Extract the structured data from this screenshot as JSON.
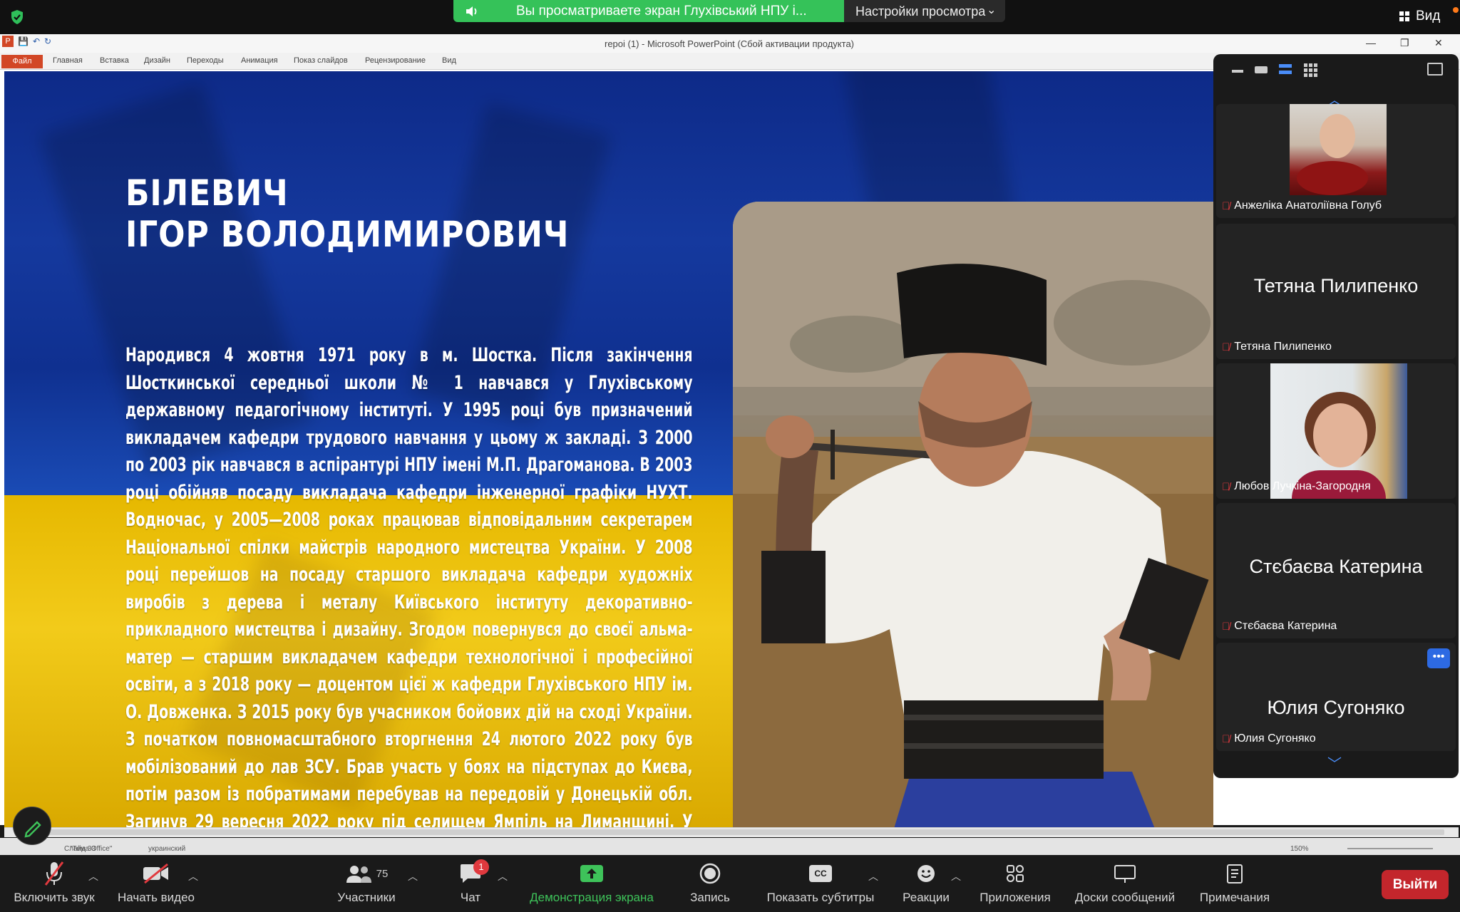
{
  "zoom_top": {
    "share_banner_text": "Вы просматриваете экран Глухівський НПУ і...",
    "view_settings_label": "Настройки просмотра",
    "view_label": "Вид"
  },
  "ppt": {
    "window_title": "repoi (1) - Microsoft PowerPoint (Сбой активации продукта)",
    "ribbon_tabs": [
      "Файл",
      "Главная",
      "Вставка",
      "Дизайн",
      "Переходы",
      "Анимация",
      "Показ слайдов",
      "Рецензирование",
      "Вид"
    ],
    "status": {
      "slide": "Слайд 33",
      "theme": "\"Тема Office\"",
      "language": "украинский",
      "zoom": "150%"
    }
  },
  "slide": {
    "title_line1": "БІЛЕВИЧ",
    "title_line2": "ІГОР ВОЛОДИМИРОВИЧ",
    "body": "Народився 4 жовтня 1971 року в м. Шостка. Після закінчення Шосткинської середньої школи № 1 навчався у Глухівському державному педагогічному інституті. У 1995 році був призначений викладачем кафедри трудового навчання у цьому ж закладі. З 2000 по 2003 рік навчався в аспірантурі НПУ імені М.П. Драгоманова. В 2003 році обійняв посаду викладача кафедри інженерної графіки НУХТ. Водночас, у 2005—2008 роках працював відповідальним секретарем Національної спілки майстрів народного мистецтва України. У 2008 році перейшов на посаду старшого викладача кафедри художніх виробів з дерева і металу Київського інституту декоративно-прикладного мистецтва і дизайну. Згодом повернувся до своєї альма-матер — старшим викладачем кафедри технологічної і професійної освіти, а з 2018 року — доцентом цієї ж кафедри Глухівського НПУ ім. О. Довженка. З 2015 року був учасником бойових дій на сході України. З початком повномасштабного вторгнення 24 лютого 2022 року був мобілізований до лав ЗСУ. Брав участь у боях на підступах до Києва, потім разом із побратимами перебував на передовій у Донецькій обл. Загинув 29 вересня 2022 року під селищем Ямпіль на Лиманщині. У загиблого залишилися дружина Світлана та син Володимир."
  },
  "gallery": {
    "participants": [
      {
        "name": "Анжеліка Анатоліївна Голуб",
        "has_video": true
      },
      {
        "name": "Тетяна Пилипенко",
        "has_video": false
      },
      {
        "name": "Любов Лучкіна-Загородня",
        "has_video": true
      },
      {
        "name": "Стєбаєва Катерина",
        "has_video": false
      },
      {
        "name": "Юлия Сугоняко",
        "has_video": false
      }
    ]
  },
  "toolbar": {
    "unmute": "Включить звук",
    "start_video": "Начать видео",
    "participants": "Участники",
    "participants_count": "75",
    "chat": "Чат",
    "chat_badge": "1",
    "share": "Демонстрация экрана",
    "record": "Запись",
    "captions": "Показать субтитры",
    "reactions": "Реакции",
    "apps": "Приложения",
    "whiteboards": "Доски сообщений",
    "notes": "Примечания",
    "leave": "Выйти"
  }
}
